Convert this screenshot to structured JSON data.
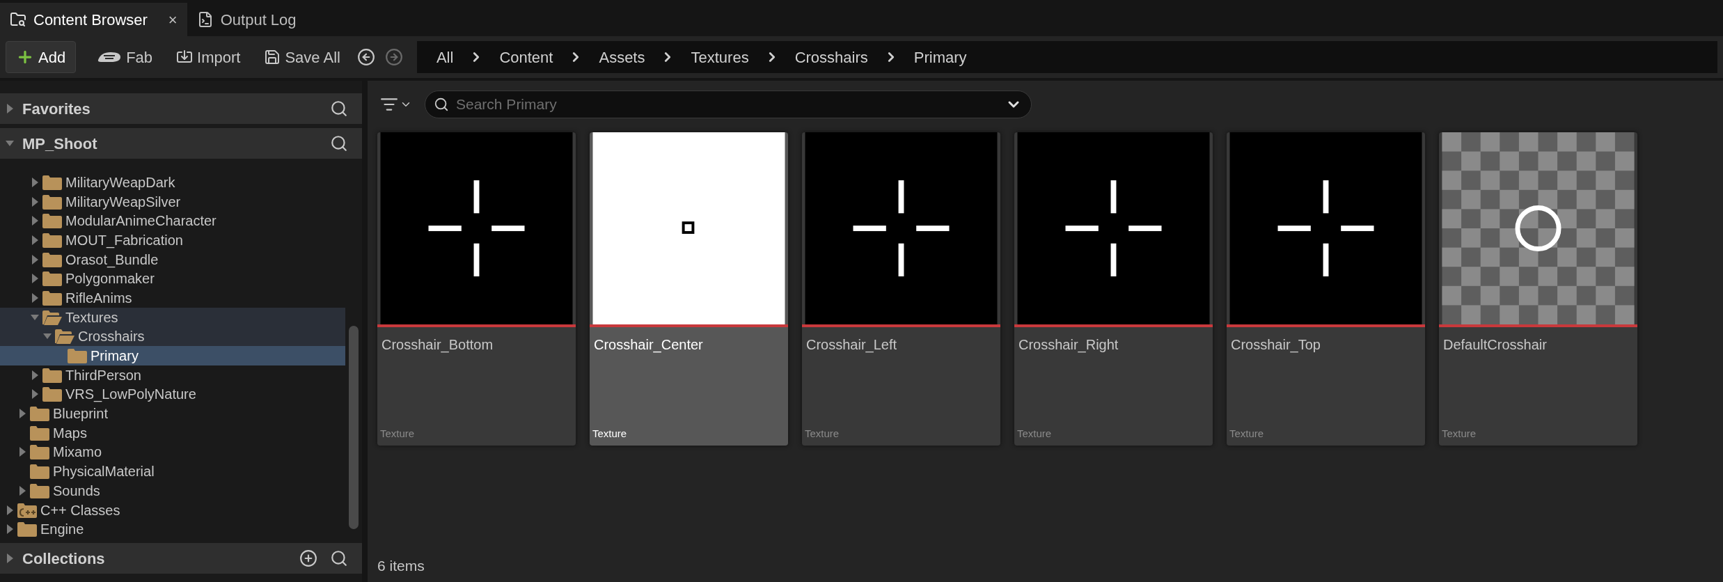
{
  "tabs": [
    {
      "label": "Content Browser",
      "kind": "browser",
      "selected": true,
      "closable": true,
      "close": "×"
    },
    {
      "label": "Output Log",
      "kind": "log",
      "selected": false,
      "closable": false
    }
  ],
  "toolbar": {
    "buttons": [
      {
        "kind": "add",
        "label": "Add"
      },
      {
        "kind": "fab",
        "label": "Fab"
      },
      {
        "kind": "import",
        "label": "Import"
      },
      {
        "kind": "save",
        "label": "Save All"
      }
    ],
    "nav": [
      {
        "kind": "back",
        "disabled": false
      },
      {
        "kind": "forward",
        "disabled": true
      }
    ]
  },
  "breadcrumb": [
    "All",
    "Content",
    "Assets",
    "Textures",
    "Crosshairs",
    "Primary"
  ],
  "sidebar": {
    "sections": [
      {
        "title": "Favorites",
        "expanded": false,
        "actions": [
          {
            "kind": "search"
          }
        ]
      },
      {
        "title": "MP_Shoot",
        "expanded": true,
        "actions": [
          {
            "kind": "search"
          }
        ],
        "tree": [
          {
            "children": [
              {
                "children": [
                  {
                    "label": "MilitaryWeapDark",
                    "kind": "folder",
                    "has_children": true,
                    "expanded": false,
                    "selected": false,
                    "in_path": false
                  },
                  {
                    "label": "MilitaryWeapSilver",
                    "kind": "folder",
                    "has_children": true,
                    "expanded": false,
                    "selected": false,
                    "in_path": false
                  },
                  {
                    "label": "ModularAnimeCharacter",
                    "kind": "folder",
                    "has_children": true,
                    "expanded": false,
                    "selected": false,
                    "in_path": false
                  },
                  {
                    "label": "MOUT_Fabrication",
                    "kind": "folder",
                    "has_children": true,
                    "expanded": false,
                    "selected": false,
                    "in_path": false
                  },
                  {
                    "label": "Orasot_Bundle",
                    "kind": "folder",
                    "has_children": true,
                    "expanded": false,
                    "selected": false,
                    "in_path": false
                  },
                  {
                    "label": "Polygonmaker",
                    "kind": "folder",
                    "has_children": true,
                    "expanded": false,
                    "selected": false,
                    "in_path": false
                  },
                  {
                    "label": "RifleAnims",
                    "kind": "folder",
                    "has_children": true,
                    "expanded": false,
                    "selected": false,
                    "in_path": false
                  },
                  {
                    "label": "Textures",
                    "kind": "folder",
                    "has_children": true,
                    "expanded": true,
                    "selected": false,
                    "in_path": true,
                    "children": [
                      {
                        "label": "Crosshairs",
                        "kind": "folder",
                        "has_children": true,
                        "expanded": true,
                        "selected": false,
                        "in_path": true,
                        "children": [
                          {
                            "label": "Primary",
                            "kind": "folder",
                            "has_children": false,
                            "expanded": false,
                            "selected": true
                          }
                        ]
                      }
                    ]
                  },
                  {
                    "label": "ThirdPerson",
                    "kind": "folder",
                    "has_children": true,
                    "expanded": false,
                    "selected": false,
                    "in_path": false
                  },
                  {
                    "label": "VRS_LowPolyNature",
                    "kind": "folder",
                    "has_children": true,
                    "expanded": false,
                    "selected": false,
                    "in_path": false
                  }
                ]
              },
              {
                "label": "Blueprint",
                "kind": "folder",
                "has_children": true,
                "expanded": false,
                "selected": false,
                "in_path": false
              },
              {
                "label": "Maps",
                "kind": "folder",
                "has_children": false,
                "expanded": false,
                "selected": false,
                "in_path": false
              },
              {
                "label": "Mixamo",
                "kind": "folder",
                "has_children": true,
                "expanded": false,
                "selected": false,
                "in_path": false
              },
              {
                "label": "PhysicalMaterial",
                "kind": "folder",
                "has_children": false,
                "expanded": false,
                "selected": false,
                "in_path": false
              },
              {
                "label": "Sounds",
                "kind": "folder",
                "has_children": true,
                "expanded": false,
                "selected": false,
                "in_path": false
              }
            ]
          },
          {
            "label": "C++ Classes",
            "kind": "cpp",
            "has_children": true,
            "expanded": false,
            "selected": false,
            "in_path": false
          },
          {
            "label": "Engine",
            "kind": "folder",
            "has_children": true,
            "expanded": false,
            "selected": false,
            "in_path": false
          }
        ]
      },
      {
        "title": "Collections",
        "expanded": false,
        "actions": [
          {
            "kind": "add"
          },
          {
            "kind": "search"
          }
        ]
      }
    ]
  },
  "search": {
    "placeholder": "Search Primary"
  },
  "assets": [
    {
      "name": "Crosshair_Bottom",
      "type": "Texture",
      "thumbnail": {
        "kind": "crosshair"
      },
      "selected": false
    },
    {
      "name": "Crosshair_Center",
      "type": "Texture",
      "thumbnail": {
        "kind": "square"
      },
      "selected": true
    },
    {
      "name": "Crosshair_Left",
      "type": "Texture",
      "thumbnail": {
        "kind": "crosshair"
      },
      "selected": false
    },
    {
      "name": "Crosshair_Right",
      "type": "Texture",
      "thumbnail": {
        "kind": "crosshair"
      },
      "selected": false
    },
    {
      "name": "Crosshair_Top",
      "type": "Texture",
      "thumbnail": {
        "kind": "crosshair"
      },
      "selected": false
    },
    {
      "name": "DefaultCrosshair",
      "type": "Texture",
      "thumbnail": {
        "kind": "ring"
      },
      "selected": false
    }
  ],
  "status_bar": {
    "count": "6 items"
  }
}
